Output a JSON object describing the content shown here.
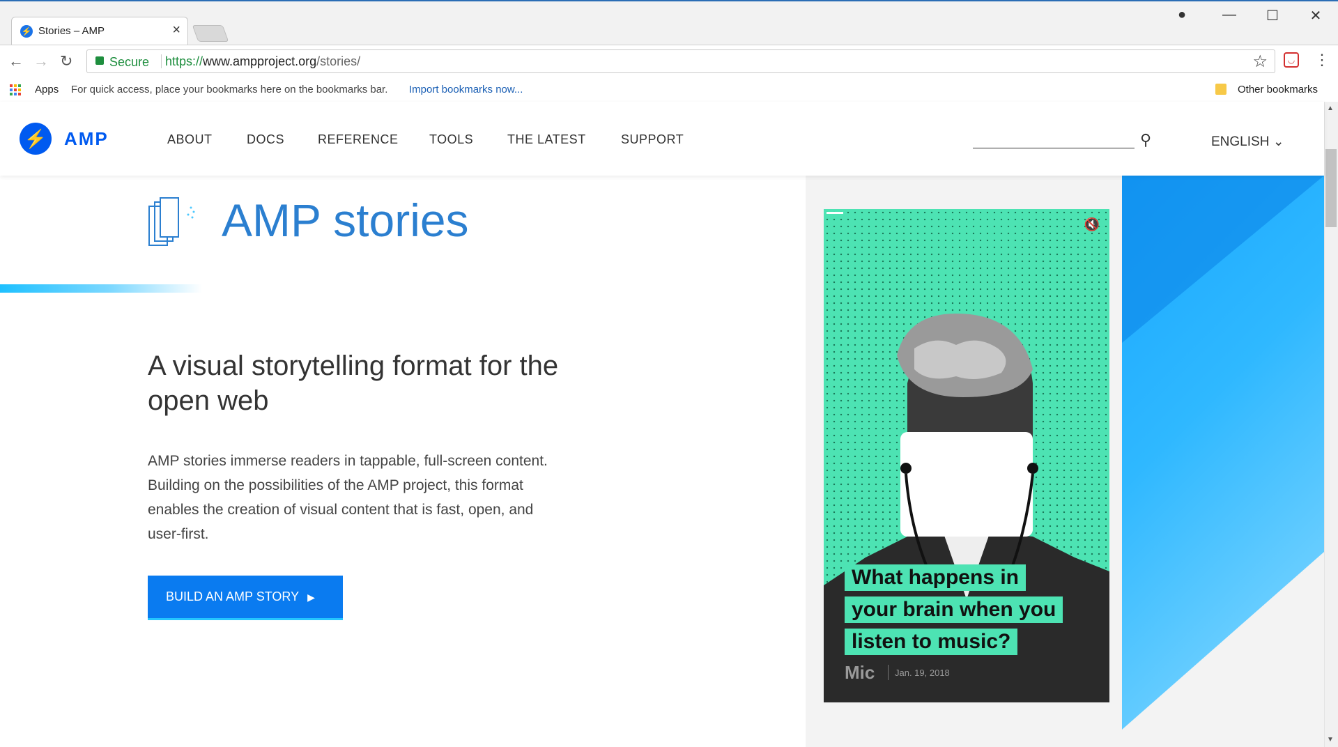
{
  "browser": {
    "tab_title": "Stories – AMP",
    "tab_favicon": "amp-bolt-icon",
    "close_glyph": "×",
    "window_minimize": "—",
    "window_maximize": "☐",
    "window_close": "✕",
    "secure_label": "Secure",
    "url_scheme": "https://",
    "url_host": "www.ampproject.org",
    "url_path": "/stories/",
    "bookmarks": {
      "apps_label": "Apps",
      "hint": "For quick access, place your bookmarks here on the bookmarks bar.",
      "import_link": "Import bookmarks now...",
      "other": "Other bookmarks"
    }
  },
  "nav": {
    "logo_text": "AMP",
    "items": [
      "ABOUT",
      "DOCS",
      "REFERENCE",
      "TOOLS",
      "THE LATEST",
      "SUPPORT"
    ],
    "language": "ENGLISH"
  },
  "hero": {
    "title": "AMP stories",
    "tagline": "A visual storytelling format for the open web",
    "description": "AMP stories immerse readers in tappable, full-screen content. Building on the possibilities of the AMP project, this format enables the creation of visual content that is fast, open, and user-first.",
    "cta_label": "BUILD AN AMP STORY"
  },
  "story": {
    "caption_lines": [
      "What happens in",
      "your brain when you",
      "listen to music?"
    ],
    "publisher": "Mic",
    "date": "Jan. 19, 2018"
  },
  "colors": {
    "brand": "#005af0",
    "title_blue": "#2b7fd0",
    "cta": "#0a7bf0",
    "story_bg": "#4de3b3"
  }
}
